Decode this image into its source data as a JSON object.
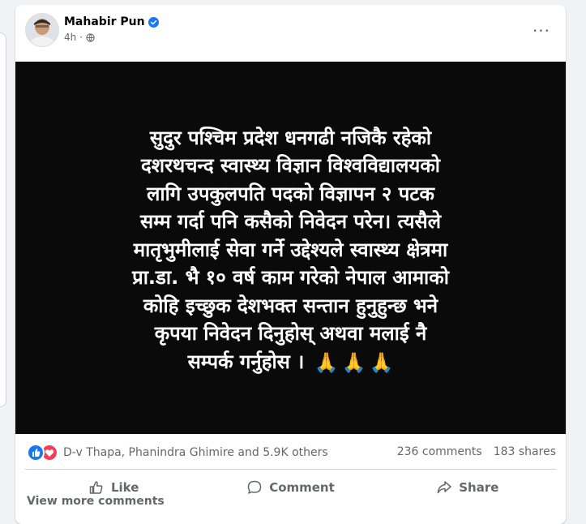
{
  "post": {
    "author": "Mahabir Pun",
    "time": "4h",
    "more_label": "···",
    "image_text_lines": [
      "सुदुर पश्चिम प्रदेश धनगढी नजिकै रहेको",
      "दशरथचन्द स्वास्थ्य विज्ञान विश्वविद्यालयको",
      "लागि उपकुलपति पदको विज्ञापन २ पटक",
      "सम्म गर्दा पनि कसैको निवेदन परेन। त्यसैले",
      "मातृभुमीलाई सेवा गर्ने उद्देश्यले स्वास्थ्य क्षेत्रमा",
      "प्रा.डा. भै १० वर्ष काम गरेको नेपाल आमाको",
      "कोहि इच्छुक देशभक्त सन्तान हुनुहुन्छ भने",
      "कृपया निवेदन दिनुहोस् अथवा मलाई नै",
      "सम्पर्क गर्नुहोस ।"
    ],
    "emojis": [
      "🙏",
      "🙏",
      "🙏"
    ]
  },
  "stats": {
    "reaction_names": "D-v Thapa, Phanindra Ghimire and 5.9K others",
    "comments": "236 comments",
    "shares": "183 shares"
  },
  "actions": {
    "like": "Like",
    "comment": "Comment",
    "share": "Share"
  },
  "footer": {
    "view_more": "View more comments"
  },
  "colors": {
    "accent": "#1877f2",
    "love": "#f33e58",
    "muted_text": "#65676b"
  }
}
